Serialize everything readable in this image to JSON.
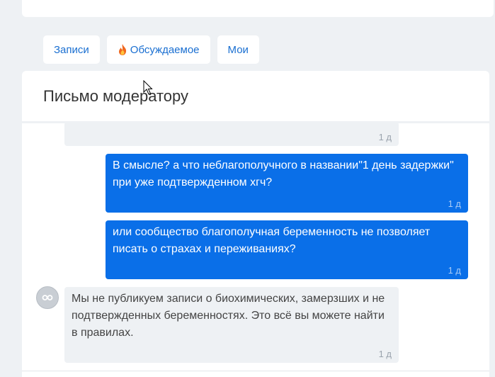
{
  "tabs": [
    {
      "label": "Записи"
    },
    {
      "label": "Обсуждаемое",
      "icon": "fire-icon"
    },
    {
      "label": "Мои"
    }
  ],
  "chat": {
    "title": "Письмо модератору",
    "messages": [
      {
        "direction": "in",
        "text": "",
        "time": "1 д"
      },
      {
        "direction": "out",
        "text": "В смысле? а что неблагополучного в названии\"1 день задержки\" при уже подтвержденном хгч?",
        "time": "1 д"
      },
      {
        "direction": "out",
        "text": "или сообщество благополучная беременность не позволяет писать о страхах и переживаниях?",
        "time": "1 д"
      },
      {
        "direction": "in",
        "text": "Мы не публикуем записи о биохимических, замерзших и не подтвержденных беременностях. Это всё вы можете найти в правилах.",
        "time": "1 д",
        "avatar": "moderator-avatar-icon"
      }
    ]
  },
  "colors": {
    "accent": "#1a6fd1",
    "outgoing_bubble": "#0a6fe8",
    "incoming_bubble": "#eef1f4",
    "page_bg": "#eef1f4"
  }
}
